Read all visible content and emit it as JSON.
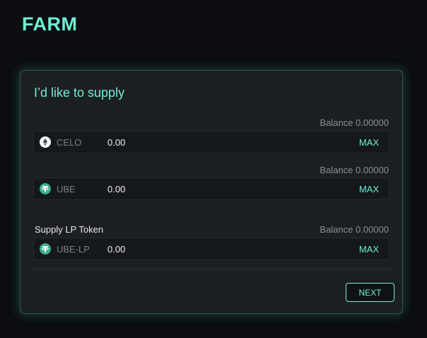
{
  "header": {
    "title": "FARM"
  },
  "card": {
    "title": "I’d like to supply",
    "rows": [
      {
        "label": "",
        "balance": "Balance 0.00000",
        "token": "CELO",
        "icon": "celo-icon",
        "amount": "0.00",
        "max_label": "MAX"
      },
      {
        "label": "",
        "balance": "Balance 0.00000",
        "token": "UBE",
        "icon": "ube-icon",
        "amount": "0.00",
        "max_label": "MAX"
      },
      {
        "label": "Supply LP Token",
        "balance": "Balance 0.00000",
        "token": "UBE-LP",
        "icon": "ube-lp-icon",
        "amount": "0.00",
        "max_label": "MAX"
      }
    ],
    "next_label": "NEXT"
  },
  "colors": {
    "accent": "#6ff0d2",
    "background": "#0b0d10",
    "card": "#1b1e22",
    "token_icon": "#3fae8c"
  }
}
